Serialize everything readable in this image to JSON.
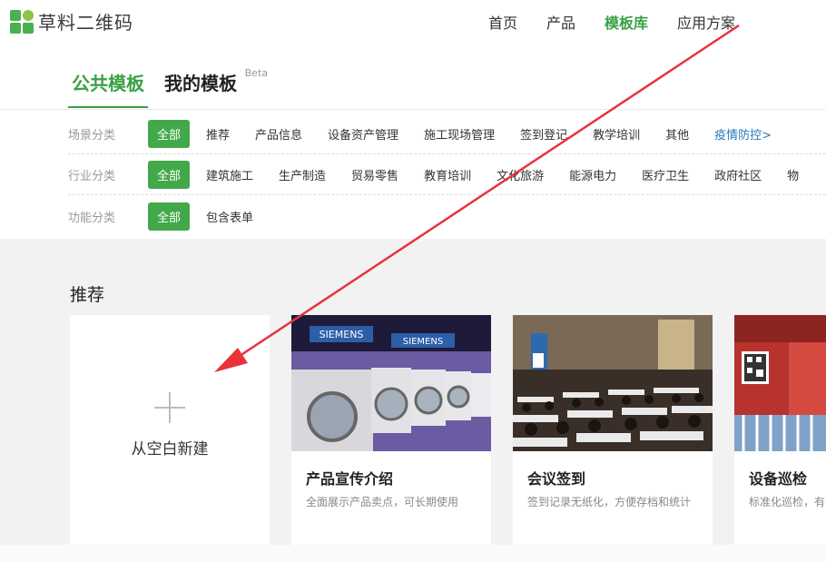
{
  "logo": {
    "text": "草料二维码",
    "mark_colors": [
      "#4caf50",
      "#8bc34a",
      "#4caf50",
      "#4caf50"
    ]
  },
  "nav": [
    {
      "label": "首页",
      "active": false
    },
    {
      "label": "产品",
      "active": false
    },
    {
      "label": "模板库",
      "active": true
    },
    {
      "label": "应用方案",
      "active": false
    }
  ],
  "tabs": [
    {
      "label": "公共模板",
      "active": true
    },
    {
      "label": "我的模板",
      "active": false,
      "badge": "Beta"
    }
  ],
  "filters": {
    "scene": {
      "label": "场景分类",
      "items": [
        "全部",
        "推荐",
        "产品信息",
        "设备资产管理",
        "施工现场管理",
        "签到登记",
        "教学培训",
        "其他",
        "疫情防控>"
      ]
    },
    "industry": {
      "label": "行业分类",
      "items": [
        "全部",
        "建筑施工",
        "生产制造",
        "贸易零售",
        "教育培训",
        "文化旅游",
        "能源电力",
        "医疗卫生",
        "政府社区",
        "物"
      ]
    },
    "function": {
      "label": "功能分类",
      "items": [
        "全部",
        "包含表单"
      ]
    }
  },
  "section": {
    "title": "推荐"
  },
  "cards": {
    "blank": {
      "label": "从空白新建"
    },
    "items": [
      {
        "title": "产品宣传介绍",
        "desc": "全面展示产品卖点，可长期使用",
        "image": "washing-machines-photo"
      },
      {
        "title": "会议签到",
        "desc": "签到记录无纸化，方便存档和统计",
        "image": "conference-photo"
      },
      {
        "title": "设备巡检",
        "desc": "标准化巡检，有",
        "image": "equipment-photo"
      }
    ]
  },
  "colors": {
    "brand": "#3aa045",
    "link": "#2a7ab8",
    "annotation": "#e8333a"
  }
}
